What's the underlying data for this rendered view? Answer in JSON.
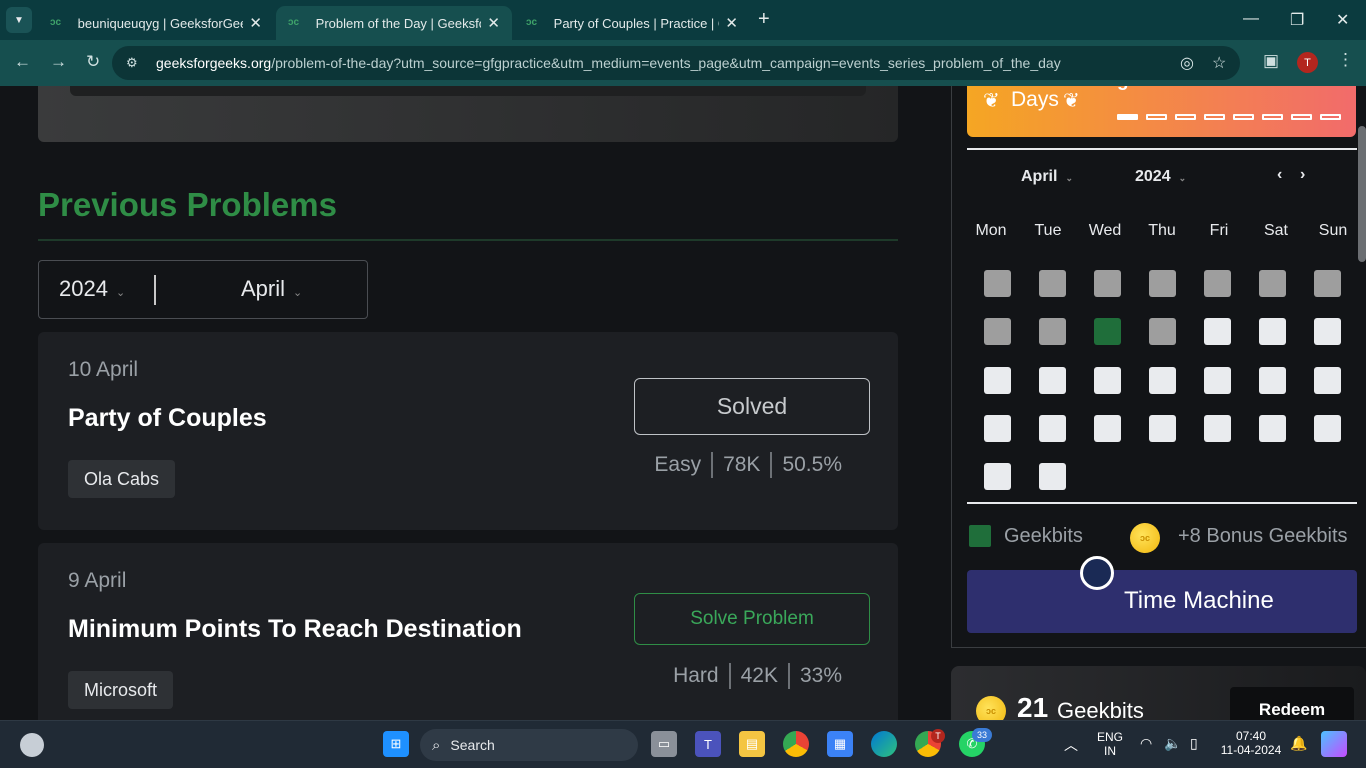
{
  "browser": {
    "tabs": [
      {
        "title": "beuniqueuqyg | GeeksforGeeks"
      },
      {
        "title": "Problem of the Day | GeeksforGeeks"
      },
      {
        "title": "Party of Couples | Practice | GeeksforGeeks"
      }
    ],
    "url_domain": "geeksforgeeks.org",
    "url_path": "/problem-of-the-day?utm_source=gfgpractice&utm_medium=events_page&utm_campaign=events_series_problem_of_the_day",
    "profile_initial": "T"
  },
  "streak": {
    "days_label": "Days",
    "geekbits_label": "geekbits",
    "dashes_total": 8,
    "dashes_filled": 1
  },
  "previous": {
    "title": "Previous Problems",
    "year": "2024",
    "month": "April",
    "problems": [
      {
        "date": "10 April",
        "name": "Party of Couples",
        "company": "Ola Cabs",
        "action": "Solved",
        "difficulty": "Easy",
        "submissions": "78K",
        "accuracy": "50.5%"
      },
      {
        "date": "9 April",
        "name": "Minimum Points To Reach Destination",
        "company": "Microsoft",
        "action": "Solve Problem",
        "difficulty": "Hard",
        "submissions": "42K",
        "accuracy": "33%"
      }
    ]
  },
  "calendar": {
    "month": "April",
    "year": "2024",
    "weekdays": [
      "Mon",
      "Tue",
      "Wed",
      "Thu",
      "Fri",
      "Sat",
      "Sun"
    ],
    "weeks": [
      [
        "g",
        "g",
        "g",
        "g",
        "g",
        "g",
        "g"
      ],
      [
        "g",
        "g",
        "s",
        "g",
        "w",
        "w",
        "w"
      ],
      [
        "w",
        "w",
        "w",
        "w",
        "w",
        "w",
        "w"
      ],
      [
        "w",
        "w",
        "w",
        "w",
        "w",
        "w",
        "w"
      ],
      [
        "w",
        "w",
        "",
        "",
        "",
        "",
        ""
      ]
    ],
    "colors": {
      "g": "#9e9e9e",
      "w": "#e9ebee",
      "s": "#1f6e3a"
    }
  },
  "legend": {
    "geekbits": "Geekbits",
    "bonus": "+8 Bonus Geekbits"
  },
  "time_machine": {
    "label": "Time Machine"
  },
  "geekbits_box": {
    "count": "21",
    "label": "Geekbits",
    "redeem": "Redeem"
  },
  "taskbar": {
    "search": "Search",
    "lang_top": "ENG",
    "lang_bottom": "IN",
    "time": "07:40",
    "date": "11-04-2024",
    "whatsapp_badge": "33",
    "chrome_badge": "T"
  },
  "colors": {
    "brand_green": "#2f8d46",
    "accent_purple": "#2e2f6e"
  }
}
